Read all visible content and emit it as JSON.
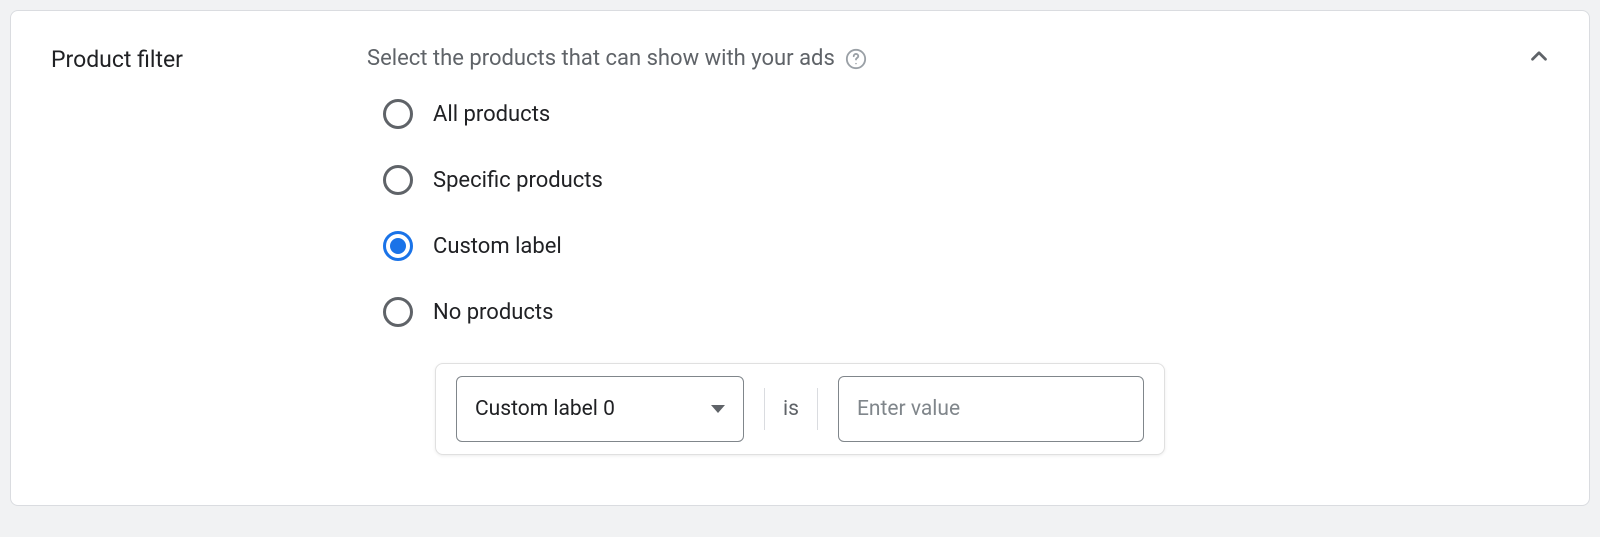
{
  "section": {
    "title": "Product filter",
    "description": "Select the products that can show with your ads"
  },
  "radios": {
    "options": [
      {
        "label": "All products",
        "selected": false
      },
      {
        "label": "Specific products",
        "selected": false
      },
      {
        "label": "Custom label",
        "selected": true
      },
      {
        "label": "No products",
        "selected": false
      }
    ]
  },
  "filter": {
    "dropdown_label": "Custom label 0",
    "operator": "is",
    "input_placeholder": "Enter value",
    "input_value": ""
  }
}
